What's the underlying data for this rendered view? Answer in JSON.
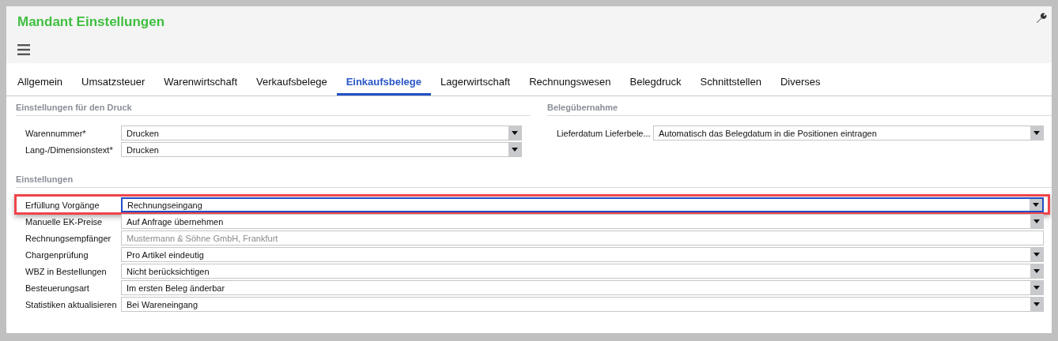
{
  "window": {
    "title": "Mandant Einstellungen"
  },
  "tabs": [
    {
      "label": "Allgemein",
      "selected": false
    },
    {
      "label": "Umsatzsteuer",
      "selected": false
    },
    {
      "label": "Warenwirtschaft",
      "selected": false
    },
    {
      "label": "Verkaufsbelege",
      "selected": false
    },
    {
      "label": "Einkaufsbelege",
      "selected": true
    },
    {
      "label": "Lagerwirtschaft",
      "selected": false
    },
    {
      "label": "Rechnungswesen",
      "selected": false
    },
    {
      "label": "Belegdruck",
      "selected": false
    },
    {
      "label": "Schnittstellen",
      "selected": false
    },
    {
      "label": "Diverses",
      "selected": false
    }
  ],
  "print_section": {
    "title": "Einstellungen für den Druck",
    "fields": [
      {
        "label": "Warennummer*",
        "kind": "select",
        "value": "Drucken"
      },
      {
        "label": "Lang-/Dimensionstext*",
        "kind": "select",
        "value": "Drucken"
      }
    ]
  },
  "transfer_section": {
    "title": "Belegübernahme",
    "fields": [
      {
        "label": "Lieferdatum Lieferbele...",
        "kind": "select",
        "value": "Automatisch das Belegdatum in die Positionen eintragen"
      }
    ]
  },
  "settings_section": {
    "title": "Einstellungen",
    "fields": [
      {
        "label": "Erfüllung Vorgänge",
        "kind": "select",
        "value": "Rechnungseingang",
        "focused": true,
        "highlighted": true
      },
      {
        "label": "Manuelle EK-Preise",
        "kind": "select",
        "value": "Auf Anfrage übernehmen",
        "focused": false,
        "highlighted": false
      },
      {
        "label": "Rechnungsempfänger",
        "kind": "text",
        "value": "Mustermann & Söhne GmbH, Frankfurt",
        "focused": false,
        "highlighted": false,
        "disabled": true
      },
      {
        "label": "Chargenprüfung",
        "kind": "select",
        "value": "Pro Artikel eindeutig",
        "focused": false,
        "highlighted": false
      },
      {
        "label": "WBZ in Bestellungen",
        "kind": "select",
        "value": "Nicht berücksichtigen",
        "focused": false,
        "highlighted": false
      },
      {
        "label": "Besteuerungsart",
        "kind": "select",
        "value": "Im ersten Beleg änderbar",
        "focused": false,
        "highlighted": false
      },
      {
        "label": "Statistiken aktualisieren",
        "kind": "select",
        "value": "Bei Wareneingang",
        "focused": false,
        "highlighted": false
      }
    ]
  }
}
